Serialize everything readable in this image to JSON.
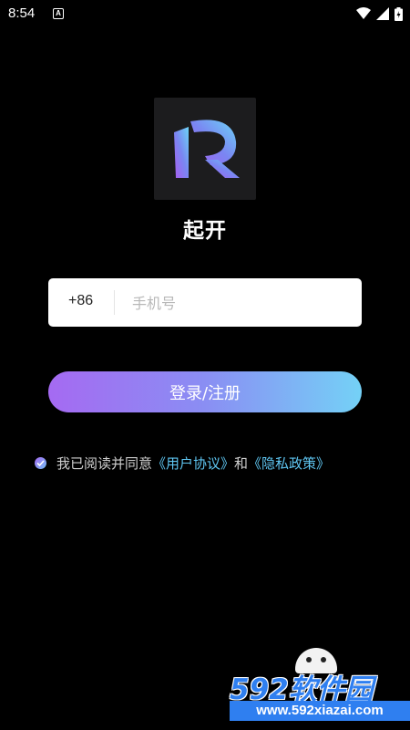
{
  "status_bar": {
    "time": "8:54",
    "icons": [
      "a-notification-icon",
      "wifi-icon",
      "signal-icon",
      "battery-icon"
    ]
  },
  "app": {
    "name": "起开",
    "logo_icon": "r-logo-icon"
  },
  "phone_login": {
    "country_code": "+86",
    "phone_placeholder": "手机号",
    "phone_value": ""
  },
  "login_button": {
    "label": "登录/注册"
  },
  "agreement": {
    "checked": true,
    "prefix": "我已阅读并同意",
    "user_agreement": "《用户协议》",
    "and": "和",
    "privacy_policy": "《隐私政策》"
  },
  "watermark": {
    "brand": "592软件园",
    "url": "www.592xiazai.com"
  },
  "colors": {
    "background": "#000000",
    "button_gradient_start": "#a56af2",
    "button_gradient_end": "#74d1f6",
    "link": "#5fc6f2",
    "watermark_blue": "#2f7ff0"
  }
}
